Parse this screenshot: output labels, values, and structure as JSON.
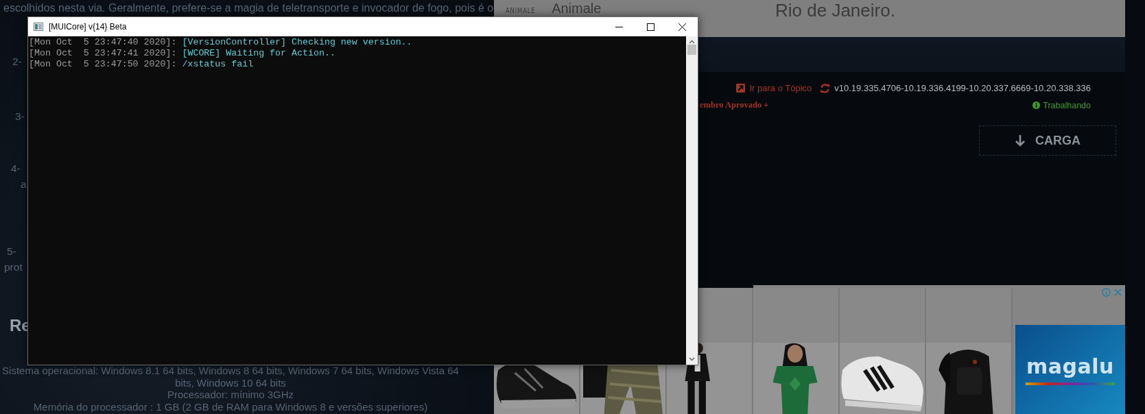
{
  "background_page": {
    "article": {
      "intro": "escolhidos nesta via. Geralmente, prefere-se a magia de teletransporte e invocador de fogo, pois é o",
      "fragments": [
        "2-",
        "3-",
        "4-",
        "a",
        "5-",
        "prot"
      ],
      "heading": "Re",
      "requirements": [
        "Sistema operacional: Windows 8.1 64 bits, Windows 8 64 bits, Windows 7 64 bits, Windows Vista 64 bits, Windows 10 64 bits",
        "Processador: mínimo 3GHz",
        "Memória do processador : 1 GB (2 GB de RAM para Windows 8 e versões superiores)"
      ]
    },
    "banner": {
      "logo": "ANIMALE",
      "brand": "Animale",
      "city": "Rio de Janeiro."
    },
    "download_panel": {
      "topic_link": "Ir para o Tópico",
      "version": "v10.19.335.4706-10.19.336.4199-10.20.337.6669-10.20.338.336",
      "member_badge": "embro Aprovado +",
      "status": "Trabalhando",
      "download_button": "CARGA"
    },
    "ad": {
      "brand_logo": "magalu"
    }
  },
  "console_window": {
    "title": "[MUICore] v{14} Beta",
    "lines": [
      {
        "timestamp": "[Mon Oct  5 23:47:40 2020]: ",
        "message": "[VersionController] Checking new version.."
      },
      {
        "timestamp": "[Mon Oct  5 23:47:41 2020]: ",
        "message": "[WCORE] Waiting for Action.."
      },
      {
        "timestamp": "[Mon Oct  5 23:47:50 2020]: ",
        "message": "/xstatus fail"
      }
    ]
  }
}
